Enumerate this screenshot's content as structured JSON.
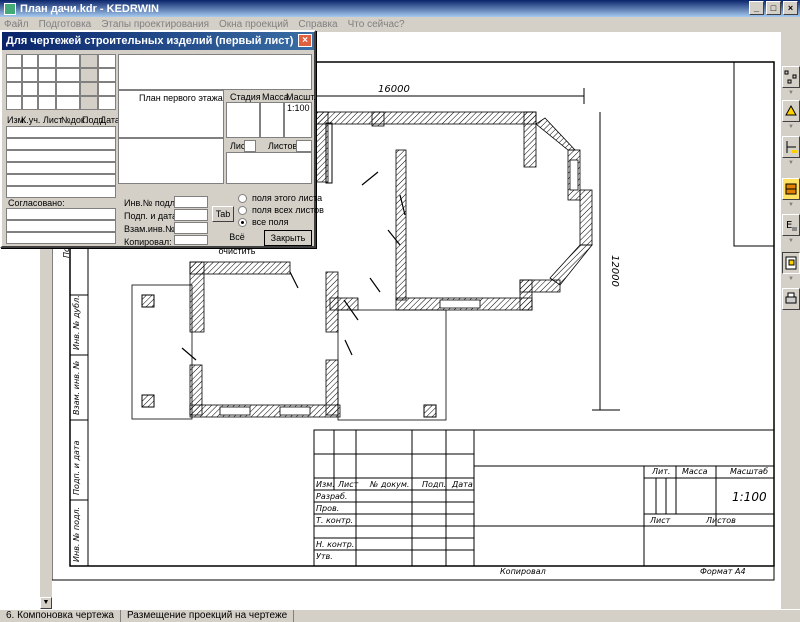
{
  "window": {
    "title": "План дачи.kdr - KEDRWIN"
  },
  "menu": [
    "Файл",
    "Подготовка",
    "Этапы проектирования",
    "Окна проекций",
    "Справка",
    "Что сейчас?"
  ],
  "dialog": {
    "title": "Для чертежей строительных изделий (первый лист)",
    "col_headers": [
      "Изм.",
      "К.уч.",
      "Лист",
      "№док.",
      "Подп.",
      "Дата"
    ],
    "drawing_name": "План первого этажа",
    "stage_label": "Стадия",
    "mass_label": "Масса",
    "scale_label": "Масшт.",
    "scale_value": "1:100",
    "sheet_label": "Лист",
    "sheets_label": "Листов",
    "agreed_label": "Согласовано:",
    "inv_orig_label": "Инв.№ подлин.:",
    "sign_date_label": "Подп. и дата:",
    "replace_inv_label": "Взам.инв.№:",
    "copied_label": "Копировал:",
    "tab_button": "Tab",
    "radio_this": "поля этого листа",
    "radio_all_sheets": "поля всех листов",
    "radio_all": "все поля",
    "clear_button": "Всё очистить",
    "close_button": "Закрыть"
  },
  "drawing": {
    "dim_width": "16000",
    "dim_height": "12000",
    "side_labels": [
      "Подп. и дата",
      "Инв. № дубл.",
      "Взам. инв. №",
      "Подп. и дата",
      "Инв. № подл."
    ],
    "tb_col_headers": [
      "Изм.",
      "Лист",
      "№ докум.",
      "Подп.",
      "Дата"
    ],
    "tb_rows": [
      "Разраб.",
      "Пров.",
      "Т. контр.",
      "",
      "Н. контр.",
      "Утв."
    ],
    "tb_stage": "Лит.",
    "tb_mass": "Масса",
    "tb_scale": "Масштаб",
    "tb_scale_value": "1:100",
    "tb_sheet": "Лист",
    "tb_sheets": "Листов",
    "copied": "Копировал",
    "format": "Формат А4"
  },
  "status": {
    "step": "6. Компоновка чертежа",
    "action": "Размещение проекций на чертеже"
  }
}
